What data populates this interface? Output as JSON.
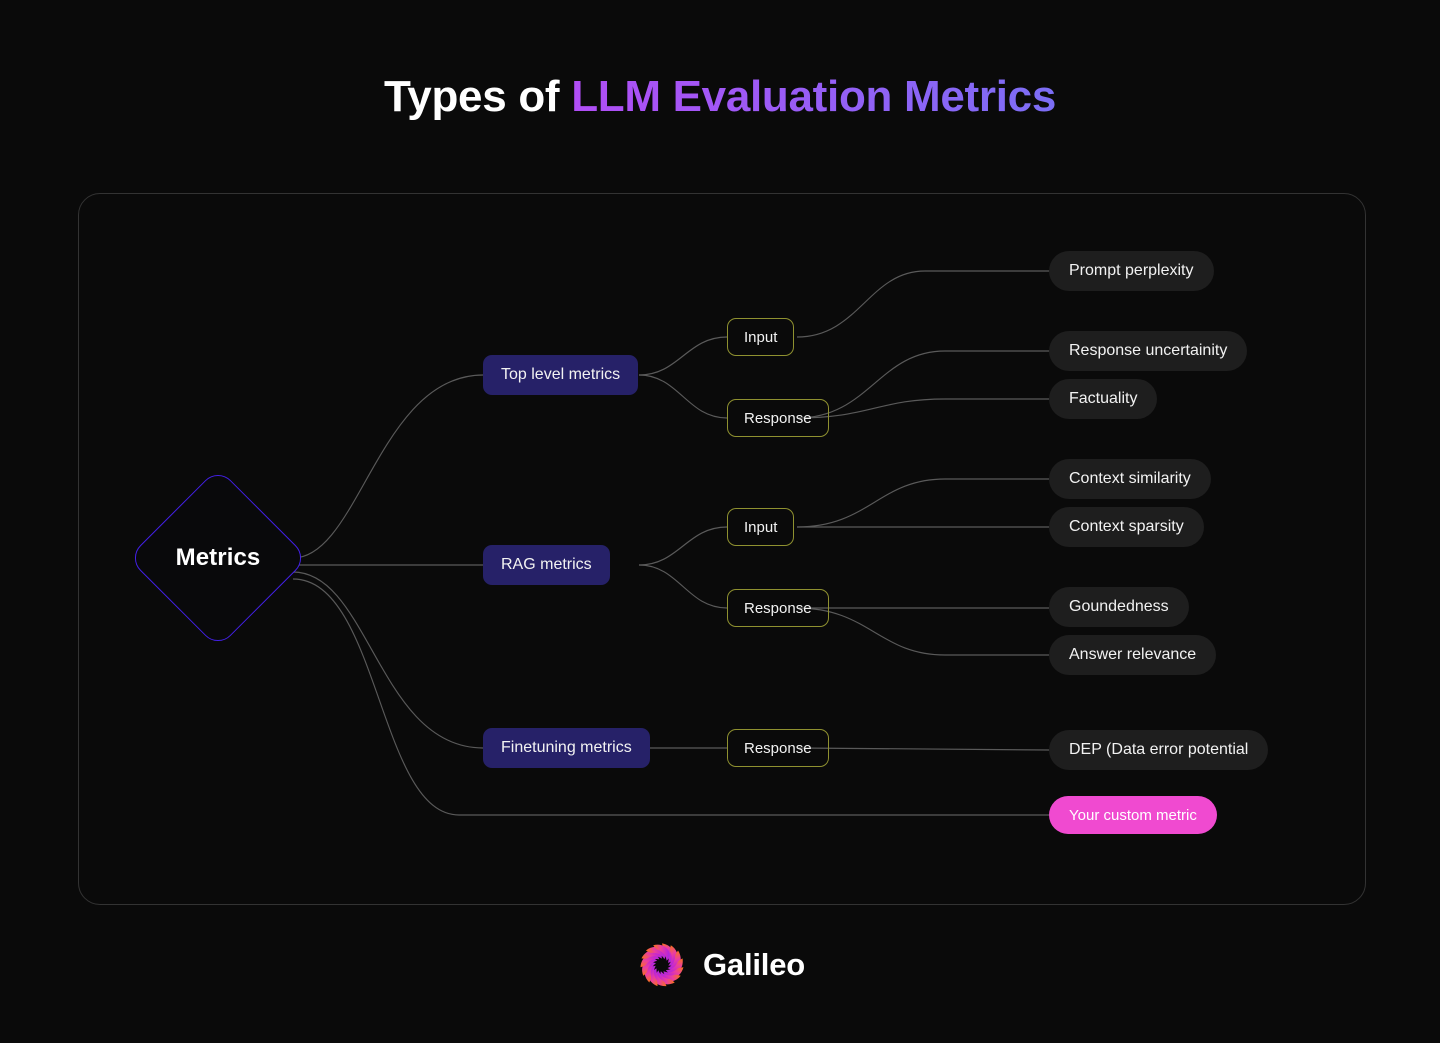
{
  "title": {
    "plain": "Types of ",
    "accent": "LLM Evaluation Metrics"
  },
  "colors": {
    "background": "#0a0a0a",
    "panel_border": "#333333",
    "edge": "#5a5a5a",
    "root_border": "#4320e8",
    "level1_fill": "#262168",
    "level2_border": "#8f9130",
    "leaf_fill": "#1e1e1e",
    "custom_metric_fill": "#f04ad0",
    "title_gradient_from": "#b14ef5",
    "title_gradient_to": "#7c6ef5"
  },
  "diagram": {
    "root": {
      "label": "Metrics"
    },
    "branches": [
      {
        "label": "Top level metrics",
        "children": [
          {
            "label": "Input",
            "leaves": [
              "Prompt perplexity"
            ]
          },
          {
            "label": "Response",
            "leaves": [
              "Response uncertainity",
              "Factuality"
            ]
          }
        ]
      },
      {
        "label": "RAG metrics",
        "children": [
          {
            "label": "Input",
            "leaves": [
              "Context similarity",
              "Context sparsity"
            ]
          },
          {
            "label": "Response",
            "leaves": [
              "Goundedness",
              "Answer relevance"
            ]
          }
        ]
      },
      {
        "label": "Finetuning metrics",
        "children": [
          {
            "label": "Response",
            "leaves": [
              "DEP (Data error potential"
            ]
          }
        ]
      }
    ],
    "custom": {
      "label": "Your custom metric"
    }
  },
  "footer": {
    "brand": "Galileo",
    "logo_icon": "galileo-swirl-logo"
  },
  "nodes": {
    "top_level_metrics": "Top level metrics",
    "rag_metrics": "RAG metrics",
    "finetuning_metrics": "Finetuning metrics",
    "input_top": "Input",
    "response_top": "Response",
    "input_rag": "Input",
    "response_rag": "Response",
    "response_ft": "Response",
    "prompt_perplexity": "Prompt perplexity",
    "response_uncertainity": "Response uncertainity",
    "factuality": "Factuality",
    "context_similarity": "Context similarity",
    "context_sparsity": "Context sparsity",
    "goundedness": "Goundedness",
    "answer_relevance": "Answer relevance",
    "dep": "DEP (Data error potential",
    "custom_metric": "Your custom metric"
  }
}
